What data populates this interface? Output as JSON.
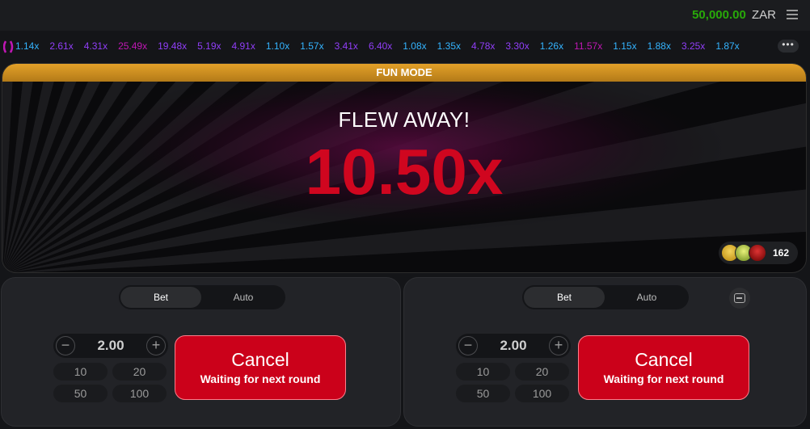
{
  "header": {
    "balance_amount": "50,000.00",
    "balance_currency": "ZAR",
    "menu_icon": "hamburger-menu-icon"
  },
  "history": {
    "logo_icon": "aviator-history-logo-icon",
    "items": [
      {
        "value": "1.14x",
        "color": "#34b4ff"
      },
      {
        "value": "2.61x",
        "color": "#913ef8"
      },
      {
        "value": "4.31x",
        "color": "#913ef8"
      },
      {
        "value": "25.49x",
        "color": "#c017b4"
      },
      {
        "value": "19.48x",
        "color": "#913ef8"
      },
      {
        "value": "5.19x",
        "color": "#913ef8"
      },
      {
        "value": "4.91x",
        "color": "#913ef8"
      },
      {
        "value": "1.10x",
        "color": "#34b4ff"
      },
      {
        "value": "1.57x",
        "color": "#34b4ff"
      },
      {
        "value": "3.41x",
        "color": "#913ef8"
      },
      {
        "value": "6.40x",
        "color": "#913ef8"
      },
      {
        "value": "1.08x",
        "color": "#34b4ff"
      },
      {
        "value": "1.35x",
        "color": "#34b4ff"
      },
      {
        "value": "4.78x",
        "color": "#913ef8"
      },
      {
        "value": "3.30x",
        "color": "#913ef8"
      },
      {
        "value": "1.26x",
        "color": "#34b4ff"
      },
      {
        "value": "11.57x",
        "color": "#c017b4"
      },
      {
        "value": "1.15x",
        "color": "#34b4ff"
      },
      {
        "value": "1.88x",
        "color": "#34b4ff"
      },
      {
        "value": "3.25x",
        "color": "#913ef8"
      },
      {
        "value": "1.87x",
        "color": "#34b4ff"
      }
    ],
    "more_icon": "more-dots-icon"
  },
  "game": {
    "banner": "FUN MODE",
    "status": "FLEW AWAY!",
    "multiplier": "10.50x",
    "multiplier_color": "#d0061f",
    "players_count": "162",
    "avatars": [
      "avatar-icon",
      "avatar-icon",
      "avatar-icon"
    ]
  },
  "panels": [
    {
      "tabs": [
        "Bet",
        "Auto"
      ],
      "active_tab": "Bet",
      "amount": "2.00",
      "chips": [
        "10",
        "20",
        "50",
        "100"
      ],
      "button_main": "Cancel",
      "button_sub": "Waiting for next round"
    },
    {
      "tabs": [
        "Bet",
        "Auto"
      ],
      "active_tab": "Bet",
      "amount": "2.00",
      "chips": [
        "10",
        "20",
        "50",
        "100"
      ],
      "button_main": "Cancel",
      "button_sub": "Waiting for next round",
      "remove_icon": "remove-panel-icon"
    }
  ],
  "colors": {
    "accent_red": "#cb011a",
    "balance_green": "#28a909",
    "fun_mode_orange": "#e3a129"
  }
}
